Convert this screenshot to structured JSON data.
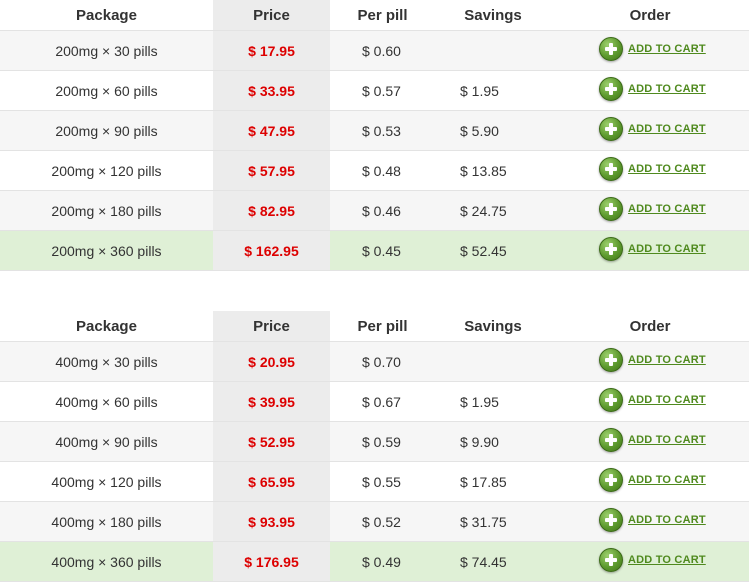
{
  "headers": {
    "package": "Package",
    "price": "Price",
    "per_pill": "Per pill",
    "savings": "Savings",
    "order": "Order"
  },
  "add_to_cart_label": "ADD TO CART",
  "tables": [
    {
      "rows": [
        {
          "package": "200mg × 30 pills",
          "price": "$ 17.95",
          "per_pill": "$ 0.60",
          "savings": ""
        },
        {
          "package": "200mg × 60 pills",
          "price": "$ 33.95",
          "per_pill": "$ 0.57",
          "savings": "$ 1.95"
        },
        {
          "package": "200mg × 90 pills",
          "price": "$ 47.95",
          "per_pill": "$ 0.53",
          "savings": "$ 5.90"
        },
        {
          "package": "200mg × 120 pills",
          "price": "$ 57.95",
          "per_pill": "$ 0.48",
          "savings": "$ 13.85"
        },
        {
          "package": "200mg × 180 pills",
          "price": "$ 82.95",
          "per_pill": "$ 0.46",
          "savings": "$ 24.75"
        },
        {
          "package": "200mg × 360 pills",
          "price": "$ 162.95",
          "per_pill": "$ 0.45",
          "savings": "$ 52.45"
        }
      ]
    },
    {
      "rows": [
        {
          "package": "400mg × 30 pills",
          "price": "$ 20.95",
          "per_pill": "$ 0.70",
          "savings": ""
        },
        {
          "package": "400mg × 60 pills",
          "price": "$ 39.95",
          "per_pill": "$ 0.67",
          "savings": "$ 1.95"
        },
        {
          "package": "400mg × 90 pills",
          "price": "$ 52.95",
          "per_pill": "$ 0.59",
          "savings": "$ 9.90"
        },
        {
          "package": "400mg × 120 pills",
          "price": "$ 65.95",
          "per_pill": "$ 0.55",
          "savings": "$ 17.85"
        },
        {
          "package": "400mg × 180 pills",
          "price": "$ 93.95",
          "per_pill": "$ 0.52",
          "savings": "$ 31.75"
        },
        {
          "package": "400mg × 360 pills",
          "price": "$ 176.95",
          "per_pill": "$ 0.49",
          "savings": "$ 74.45"
        }
      ]
    }
  ],
  "colors": {
    "price_text": "#dd0000",
    "cart_link": "#4f8a1e",
    "best_row_bg": "#dff0d6",
    "price_column_bg": "#ececec"
  },
  "icons": {
    "add": "plus-circle-icon"
  }
}
